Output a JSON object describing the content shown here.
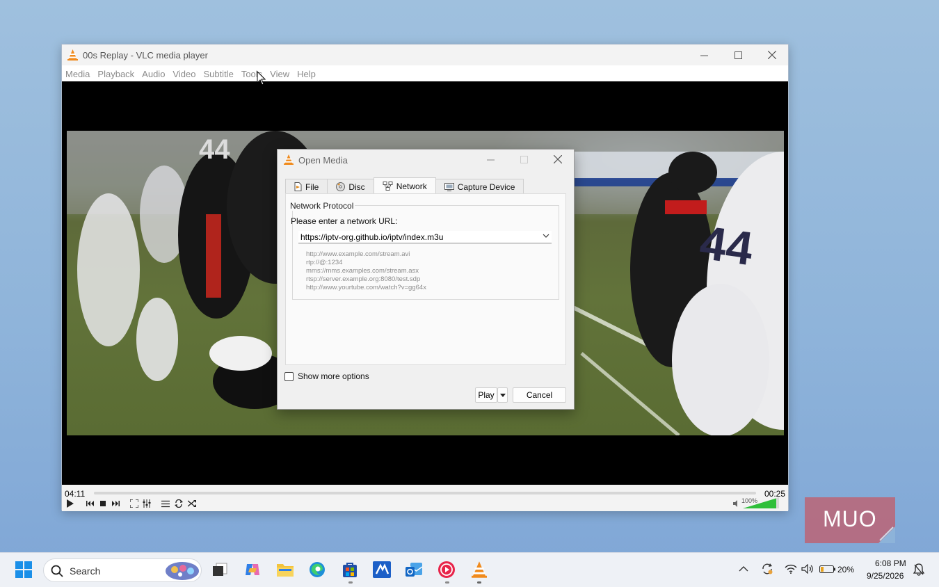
{
  "vlc": {
    "title": "00s Replay - VLC media player",
    "menu": [
      "Media",
      "Playback",
      "Audio",
      "Video",
      "Subtitle",
      "Tools",
      "View",
      "Help"
    ],
    "elapsed": "04:11",
    "remaining": "00:25",
    "volume": "100%",
    "progress": 0.0
  },
  "dialog": {
    "title": "Open Media",
    "tabs": [
      "File",
      "Disc",
      "Network",
      "Capture Device"
    ],
    "active_tab": "Network",
    "group_label": "Network Protocol",
    "url_label": "Please enter a network URL:",
    "url_value": "https://iptv-org.github.io/iptv/index.m3u",
    "examples": [
      "http://www.example.com/stream.avi",
      "rtp://@:1234",
      "mms://mms.examples.com/stream.asx",
      "rtsp://server.example.org:8080/test.sdp",
      "http://www.yourtube.com/watch?v=gg64x"
    ],
    "show_more_options": "Show more options",
    "play_label": "Play",
    "cancel_label": "Cancel"
  },
  "watermark": {
    "text": "MUO"
  },
  "taskbar": {
    "search_label": "Search",
    "battery": "20%",
    "time": "6:08 PM",
    "date": "9/25/2026"
  },
  "colors": {
    "vlc_orange": "#f08a1c",
    "accent": "#0067c0"
  }
}
